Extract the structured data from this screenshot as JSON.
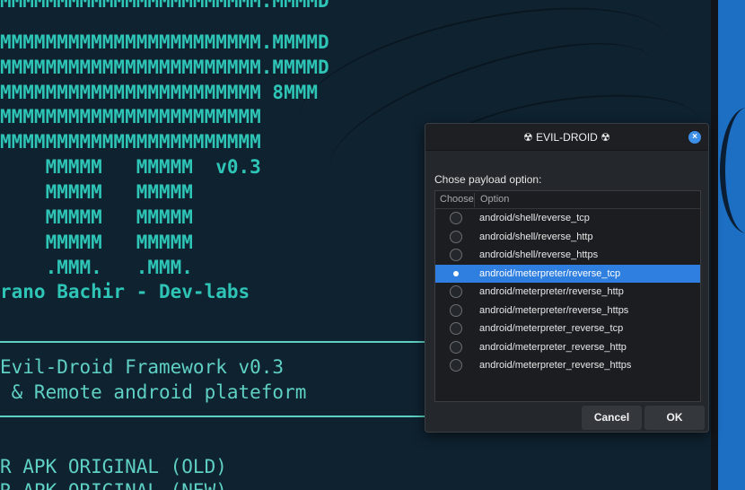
{
  "terminal": {
    "banner_lines": [
      "MMMMMMMMMMMMMMMMMMMMMMM.MMMMD",
      "MMMMMMMMMMMMMMMMMMMMMMM.MMMMD",
      "MMMMMMMMMMMMMMMMMMMMMMM.MMMMD",
      "MMMMMMMMMMMMMMMMMMMMMMM 8MMM",
      "MMMMMMMMMMMMMMMMMMMMMMM",
      "MMMMMMMMMMMMMMMMMMMMMMM",
      "    MMMMM   MMMMM  v0.3",
      "    MMMMM   MMMMM",
      "    MMMMM   MMMMM",
      "    MMMMM   MMMMM",
      "    .MMM.   .MMM.",
      "rano Bachir - Dev-labs"
    ],
    "framework_line": "Evil-Droid Framework v0.3",
    "platform_line": " & Remote android plateform",
    "menu_line_1": "R APK ORIGINAL (OLD)",
    "menu_line_2": "R APK ORIGINAL (NEW)"
  },
  "dialog": {
    "title": "EVIL-DROID",
    "title_icon_left": "☢",
    "title_icon_right": "☢",
    "close_icon": "×",
    "prompt": "Chose payload option:",
    "columns": [
      "Choose",
      "Option"
    ],
    "options": [
      {
        "label": "android/shell/reverse_tcp",
        "selected": false
      },
      {
        "label": "android/shell/reverse_http",
        "selected": false
      },
      {
        "label": "android/shell/reverse_https",
        "selected": false
      },
      {
        "label": "android/meterpreter/reverse_tcp",
        "selected": true
      },
      {
        "label": "android/meterpreter/reverse_http",
        "selected": false
      },
      {
        "label": "android/meterpreter/reverse_https",
        "selected": false
      },
      {
        "label": "android/meterpreter_reverse_tcp",
        "selected": false
      },
      {
        "label": "android/meterpreter_reverse_http",
        "selected": false
      },
      {
        "label": "android/meterpreter_reverse_https",
        "selected": false
      }
    ],
    "cancel_label": "Cancel",
    "ok_label": "OK"
  },
  "colors": {
    "terminal_text": "#2ec4b6",
    "selection": "#2f7fe0",
    "dialog_bg": "#24272b"
  }
}
